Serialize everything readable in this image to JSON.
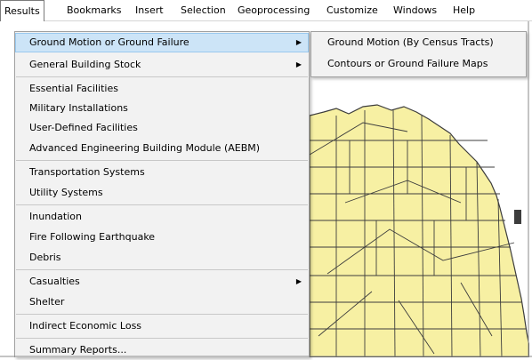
{
  "menubar": {
    "items": [
      "Results",
      "Bookmarks",
      "Insert",
      "Selection",
      "Geoprocessing",
      "Customize",
      "Windows",
      "Help"
    ]
  },
  "results_menu": {
    "items": [
      {
        "label": "Ground Motion or Ground Failure",
        "has_submenu": true,
        "highlighted": true
      },
      {
        "label": "General Building Stock",
        "has_submenu": true
      },
      {
        "label": "Essential Facilities"
      },
      {
        "label": "Military Installations"
      },
      {
        "label": "User-Defined Facilities"
      },
      {
        "label": "Advanced Engineering Building Module (AEBM)"
      },
      {
        "label": "Transportation Systems"
      },
      {
        "label": "Utility Systems"
      },
      {
        "label": "Inundation"
      },
      {
        "label": "Fire Following Earthquake"
      },
      {
        "label": "Debris"
      },
      {
        "label": "Casualties",
        "has_submenu": true
      },
      {
        "label": "Shelter"
      },
      {
        "label": "Indirect Economic Loss"
      },
      {
        "label": "Summary Reports..."
      }
    ],
    "arrow_glyph": "▶"
  },
  "submenu": {
    "items": [
      "Ground Motion (By Census Tracts)",
      "Contours or Ground Failure Maps"
    ]
  },
  "colors": {
    "map_fill": "#f7f0a3",
    "map_lines": "#3d3d3d",
    "water_bg": "#ffffff",
    "highlight": "#cce4f7"
  }
}
